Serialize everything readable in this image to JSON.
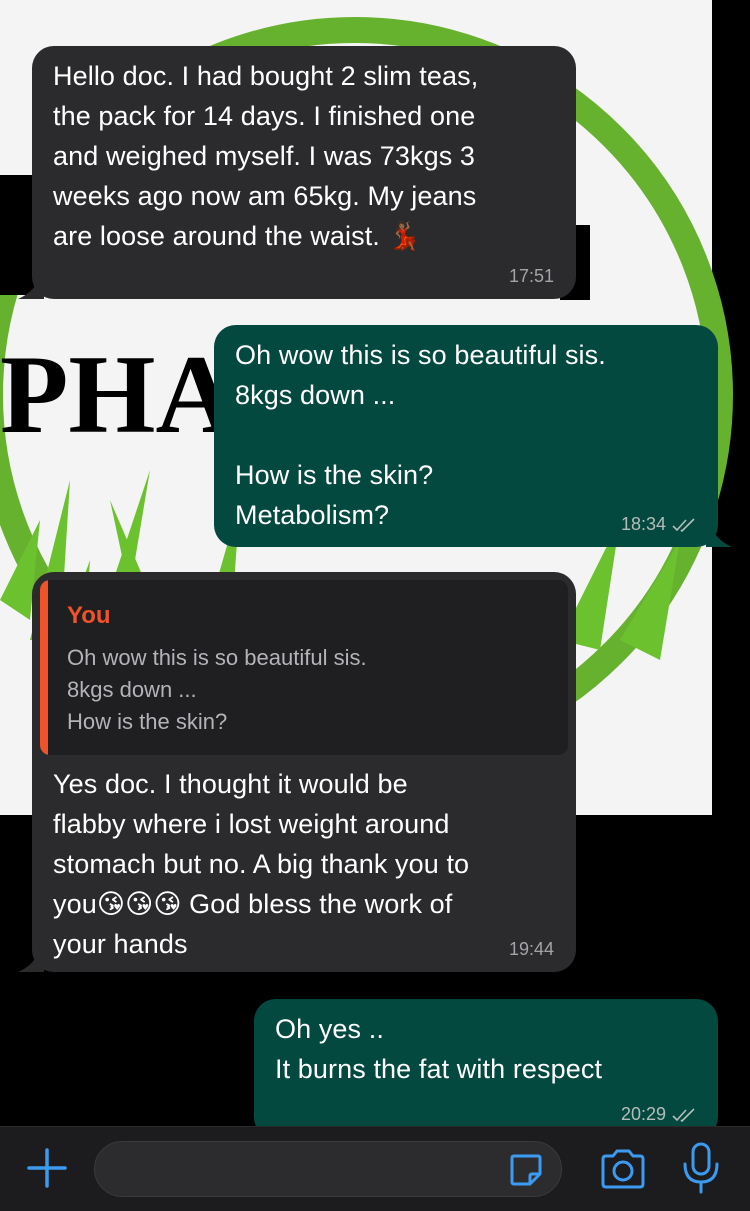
{
  "wallpaper": {
    "logo_text_fragment": "PHA",
    "colors": {
      "ring": "#66b22e",
      "grass": "#6cc12e",
      "text": "#000000",
      "background": "#f4f4f4"
    }
  },
  "chat": {
    "messages": [
      {
        "direction": "incoming",
        "text": "Hello doc. I had bought 2 slim teas,\nthe pack for 14 days. I finished one\nand weighed myself. I was 73kgs 3\nweeks ago now am 65kg. My jeans\nare loose around the waist. 💃🏾",
        "time": "17:51"
      },
      {
        "direction": "outgoing",
        "text": "Oh wow this is so beautiful sis.\n8kgs down ...\n\nHow is the skin?\nMetabolism?",
        "time": "18:34",
        "status": "read"
      },
      {
        "direction": "incoming",
        "quote": {
          "author": "You",
          "text": "Oh wow this is so beautiful sis.\n8kgs down ...\nHow is the skin?"
        },
        "text": "Yes doc. I thought it would be\nflabby where i lost weight around\nstomach but no. A big thank you to\nyou😘😘😘 God bless the work of\nyour hands",
        "time": "19:44"
      },
      {
        "direction": "outgoing",
        "text": "Oh yes ..\nIt burns the fat with respect",
        "time": "20:29",
        "status": "read"
      }
    ]
  },
  "input_bar": {
    "message_placeholder": "",
    "icons": [
      "plus-icon",
      "sticker-icon",
      "camera-icon",
      "microphone-icon"
    ],
    "accent_color": "#3b9bf0"
  },
  "colors": {
    "incoming_bubble": "#2b2b2d",
    "outgoing_bubble": "#03493f",
    "quote_accent": "#f0522a"
  }
}
